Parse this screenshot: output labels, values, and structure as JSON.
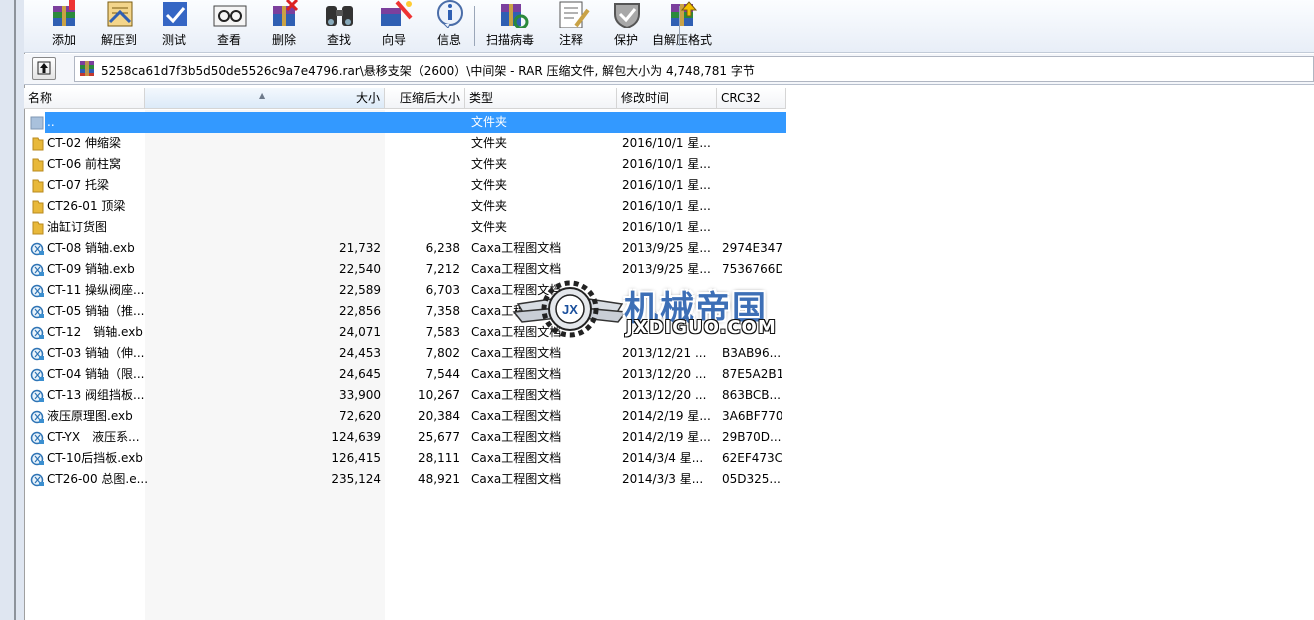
{
  "toolbar": {
    "buttons": [
      {
        "label": "添加",
        "icon": "add-archive-icon"
      },
      {
        "label": "解压到",
        "icon": "extract-to-icon"
      },
      {
        "label": "测试",
        "icon": "test-icon"
      },
      {
        "label": "查看",
        "icon": "view-icon"
      },
      {
        "label": "删除",
        "icon": "delete-icon"
      },
      {
        "label": "查找",
        "icon": "find-icon"
      },
      {
        "label": "向导",
        "icon": "wizard-icon"
      },
      {
        "label": "信息",
        "icon": "info-icon"
      },
      {
        "label": "扫描病毒",
        "icon": "virus-scan-icon"
      },
      {
        "label": "注释",
        "icon": "comment-icon"
      },
      {
        "label": "保护",
        "icon": "protect-icon"
      },
      {
        "label": "自解压格式",
        "icon": "sfx-icon"
      }
    ]
  },
  "address": {
    "path": "5258ca61d7f3b5d50de5526c9a7e4796.rar\\悬移支架（2600）\\中间架 - RAR 压缩文件, 解包大小为 4,748,781 字节"
  },
  "columns": {
    "name": "名称",
    "size": "大小",
    "packed": "压缩后大小",
    "type": "类型",
    "modified": "修改时间",
    "crc": "CRC32"
  },
  "rows": [
    {
      "name": "..",
      "size": "",
      "packed": "",
      "type": "文件夹",
      "modified": "",
      "crc": "",
      "kind": "up"
    },
    {
      "name": "CT-02 伸缩梁",
      "size": "",
      "packed": "",
      "type": "文件夹",
      "modified": "2016/10/1 星...",
      "crc": "",
      "kind": "folder"
    },
    {
      "name": "CT-06 前柱窝",
      "size": "",
      "packed": "",
      "type": "文件夹",
      "modified": "2016/10/1 星...",
      "crc": "",
      "kind": "folder"
    },
    {
      "name": "CT-07 托梁",
      "size": "",
      "packed": "",
      "type": "文件夹",
      "modified": "2016/10/1 星...",
      "crc": "",
      "kind": "folder"
    },
    {
      "name": "CT26-01 顶梁",
      "size": "",
      "packed": "",
      "type": "文件夹",
      "modified": "2016/10/1 星...",
      "crc": "",
      "kind": "folder"
    },
    {
      "name": "油缸订货图",
      "size": "",
      "packed": "",
      "type": "文件夹",
      "modified": "2016/10/1 星...",
      "crc": "",
      "kind": "folder"
    },
    {
      "name": "CT-08 销轴.exb",
      "size": "21,732",
      "packed": "6,238",
      "type": "Caxa工程图文档",
      "modified": "2013/9/25 星...",
      "crc": "2974E347",
      "kind": "exb"
    },
    {
      "name": "CT-09 销轴.exb",
      "size": "22,540",
      "packed": "7,212",
      "type": "Caxa工程图文档",
      "modified": "2013/9/25 星...",
      "crc": "7536766D",
      "kind": "exb"
    },
    {
      "name": "CT-11 操纵阀座...",
      "size": "22,589",
      "packed": "6,703",
      "type": "Caxa工程图文档",
      "modified": "",
      "crc": "",
      "kind": "exb"
    },
    {
      "name": "CT-05 销轴（推...",
      "size": "22,856",
      "packed": "7,358",
      "type": "Caxa工程图文档",
      "modified": "",
      "crc": "",
      "kind": "exb"
    },
    {
      "name": "CT-12　销轴.exb",
      "size": "24,071",
      "packed": "7,583",
      "type": "Caxa工程图文档",
      "modified": "",
      "crc": "",
      "kind": "exb"
    },
    {
      "name": "CT-03 销轴（伸...",
      "size": "24,453",
      "packed": "7,802",
      "type": "Caxa工程图文档",
      "modified": "2013/12/21 ...",
      "crc": "B3AB96...",
      "kind": "exb"
    },
    {
      "name": "CT-04 销轴（限...",
      "size": "24,645",
      "packed": "7,544",
      "type": "Caxa工程图文档",
      "modified": "2013/12/20 ...",
      "crc": "87E5A2B1",
      "kind": "exb"
    },
    {
      "name": "CT-13 阀组挡板...",
      "size": "33,900",
      "packed": "10,267",
      "type": "Caxa工程图文档",
      "modified": "2013/12/20 ...",
      "crc": "863BCB...",
      "kind": "exb"
    },
    {
      "name": "液压原理图.exb",
      "size": "72,620",
      "packed": "20,384",
      "type": "Caxa工程图文档",
      "modified": "2014/2/19 星...",
      "crc": "3A6BF770",
      "kind": "exb"
    },
    {
      "name": "CT-YX　液压系...",
      "size": "124,639",
      "packed": "25,677",
      "type": "Caxa工程图文档",
      "modified": "2014/2/19 星...",
      "crc": "29B70D...",
      "kind": "exb"
    },
    {
      "name": "CT-10后挡板.exb",
      "size": "126,415",
      "packed": "28,111",
      "type": "Caxa工程图文档",
      "modified": "2014/3/4 星...",
      "crc": "62EF473C",
      "kind": "exb"
    },
    {
      "name": "CT26-00 总图.e...",
      "size": "235,124",
      "packed": "48,921",
      "type": "Caxa工程图文档",
      "modified": "2014/3/3 星...",
      "crc": "05D325...",
      "kind": "exb"
    }
  ],
  "selected_row": 0,
  "watermark": {
    "cn": "机械帝国",
    "en": "JXDIGUO.COM",
    "logo_text": "JX"
  },
  "colors": {
    "selection": "#3399ff",
    "folder": "#e8b83a",
    "watermark_blue": "#3d6fb6"
  }
}
